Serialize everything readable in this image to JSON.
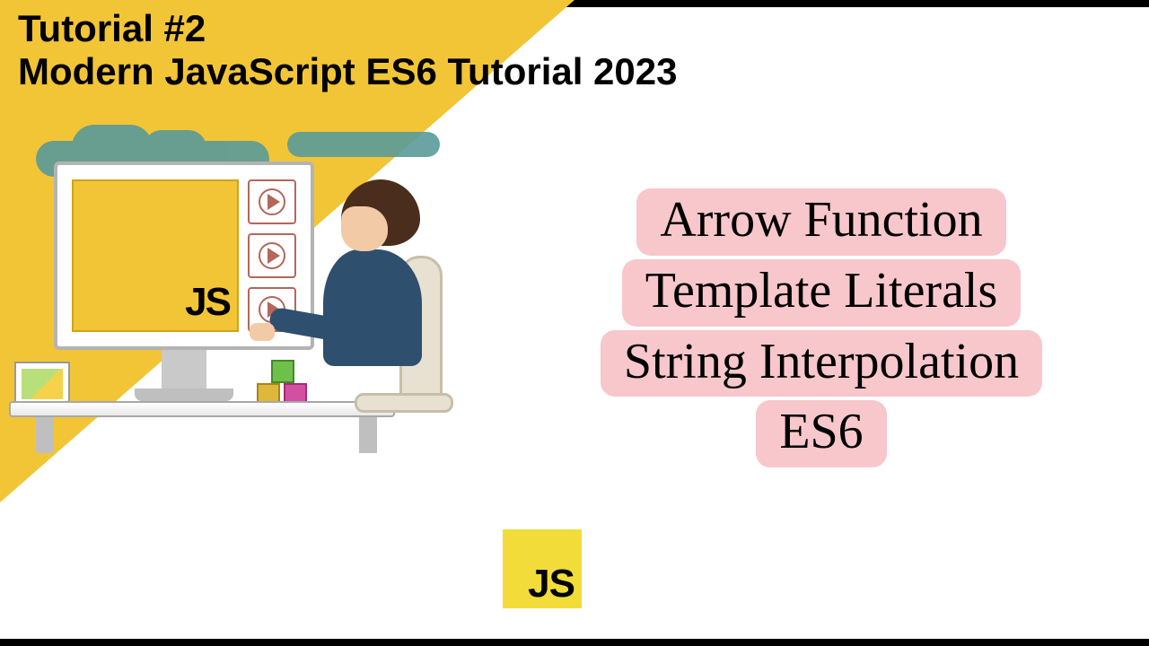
{
  "heading": {
    "line1": "Tutorial #2",
    "line2": "Modern JavaScript ES6 Tutorial 2023"
  },
  "illustration": {
    "screen_label": "JS"
  },
  "topics": [
    "Arrow Function",
    "Template Literals",
    "String Interpolation",
    "ES6"
  ],
  "badge": {
    "label": "JS"
  }
}
